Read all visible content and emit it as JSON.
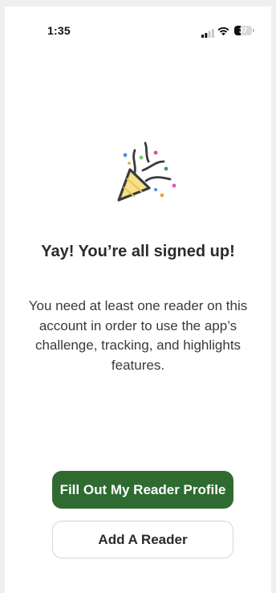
{
  "status_bar": {
    "time": "1:35",
    "battery_level": "37",
    "battery_fraction": 0.37
  },
  "icons": {
    "signal": "cellular-signal-icon",
    "wifi": "wifi-icon",
    "battery": "battery-icon",
    "celebration": "party-popper-icon"
  },
  "colors": {
    "primary_button": "#2f6b30",
    "heading_text": "#2b2b2b",
    "body_text": "#3a3a3a"
  },
  "main": {
    "heading": "Yay! You’re all signed up!",
    "description": "You need at least one reader on this account in order to use the app’s challenge, tracking, and highlights features."
  },
  "actions": {
    "primary_label": "Fill Out My Reader Profile",
    "secondary_label": "Add A Reader"
  }
}
